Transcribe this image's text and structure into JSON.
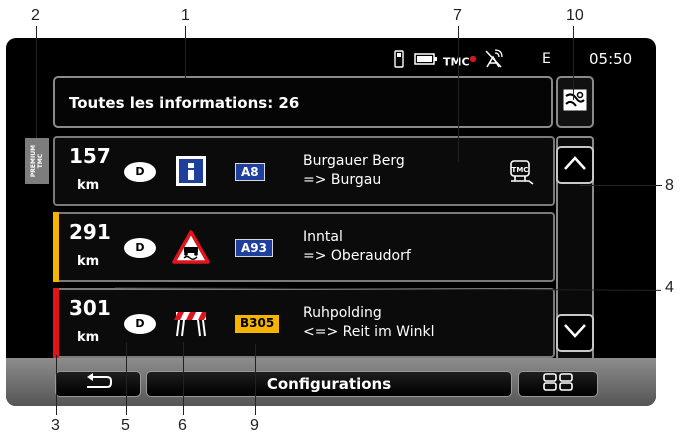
{
  "callouts": {
    "c1": "1",
    "c2": "2",
    "c3": "3",
    "c4": "4",
    "c5": "5",
    "c6": "6",
    "c7": "7",
    "c8": "8",
    "c9": "9",
    "c10": "10"
  },
  "status_bar": {
    "tmc": "TMC",
    "gps_e": "E",
    "time": "05:50"
  },
  "header": {
    "title": "Toutes les informations: 26"
  },
  "premium_tag": {
    "line1": "PREMIUM",
    "line2": "TMC"
  },
  "messages": [
    {
      "distance": "157",
      "unit": "km",
      "country": "D",
      "road": "A8",
      "loc1": "Burgauer Berg",
      "loc2": "=> Burgau",
      "icon": "info-icon",
      "severity_color": null,
      "has_tmc_icon": true
    },
    {
      "distance": "291",
      "unit": "km",
      "country": "D",
      "road": "A93",
      "loc1": "Inntal",
      "loc2": "=> Oberaudorf",
      "icon": "slippery-road-icon",
      "severity_color": "#f5b400",
      "has_tmc_icon": false
    },
    {
      "distance": "301",
      "unit": "km",
      "country": "D",
      "road": "B305",
      "loc1": "Ruhpolding",
      "loc2": "<=> Reit im Winkl",
      "icon": "roadworks-barrier-icon",
      "severity_color": "#e0141a",
      "has_tmc_icon": false
    }
  ],
  "bottom_bar": {
    "config_label": "Configurations"
  },
  "colors": {
    "road_a": "#1e3f9c",
    "road_b": "#f5b400",
    "severity_yellow": "#f5b400",
    "severity_red": "#e0141a"
  }
}
